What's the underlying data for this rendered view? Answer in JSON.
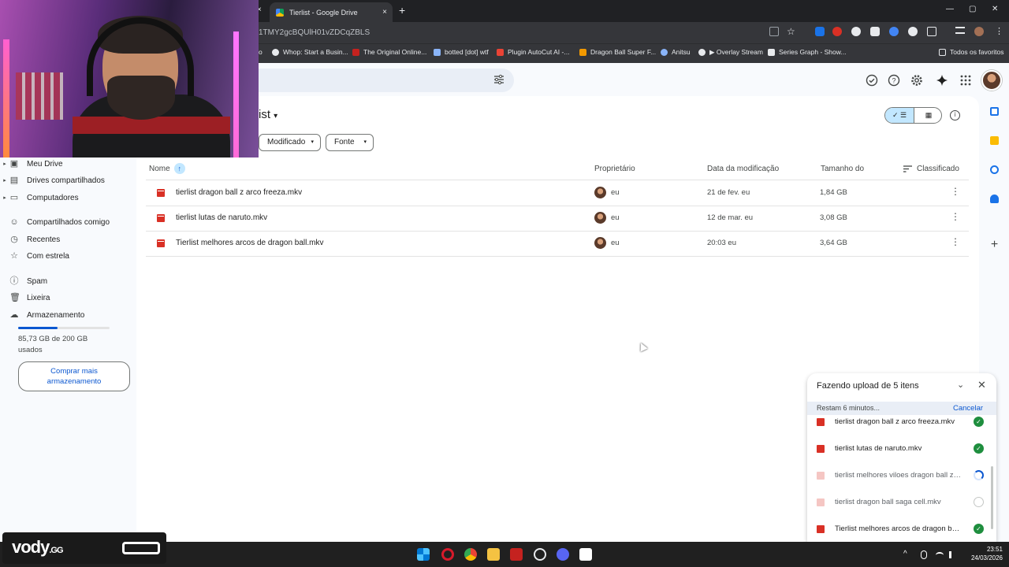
{
  "browser": {
    "tab_title": "Tierlist - Google Drive",
    "tab_close": "×",
    "prev_tab_close": "×",
    "new_tab": "+",
    "url": "1TMY2gcBQUlH01vZDCqZBLS",
    "window_controls": [
      "—",
      "▢",
      "✕"
    ],
    "bookmarks": [
      {
        "label": "o",
        "color": "#9aa0a6"
      },
      {
        "label": "Whop: Start a Busin...",
        "color": "#e8eaed"
      },
      {
        "label": "The Original Online...",
        "color": "#c5221f"
      },
      {
        "label": "botted [dot] wtf",
        "color": "#8ab4f8"
      },
      {
        "label": "Plugin AutoCut AI -...",
        "color": "#ea4335"
      },
      {
        "label": "Dragon Ball Super F...",
        "color": "#f29900"
      },
      {
        "label": "Anitsu",
        "color": "#8ab4f8"
      },
      {
        "label": "▶ Overlay Stream",
        "color": "#e8eaed"
      },
      {
        "label": "Series Graph - Show...",
        "color": "#e8eaed"
      }
    ],
    "all_favorites": "Todos os favoritos"
  },
  "drive": {
    "folder_title": "ist",
    "folder_dropdown": "▾",
    "filters": [
      {
        "label": "Modificado",
        "arrow": "▾"
      },
      {
        "label": "Fonte",
        "arrow": "▾"
      }
    ],
    "view_list_icon": "✓ ☰",
    "view_grid_icon": "▦",
    "info_icon": "i",
    "columns": {
      "name": "Nome",
      "sort_arrow": "↑",
      "owner": "Proprietário",
      "modified": "Data da modificação",
      "size": "Tamanho do",
      "sort_label": "Classificado"
    },
    "files": [
      {
        "name": "tierlist dragon ball z arco freeza.mkv",
        "owner": "eu",
        "modified": "21 de fev. eu",
        "size": "1,84 GB",
        "menu": "⋮"
      },
      {
        "name": "tierlist lutas de naruto.mkv",
        "owner": "eu",
        "modified": "12 de mar. eu",
        "size": "3,08 GB",
        "menu": "⋮"
      },
      {
        "name": "Tierlist melhores arcos de dragon ball.mkv",
        "owner": "eu",
        "modified": "20:03 eu",
        "size": "3,64 GB",
        "menu": "⋮"
      }
    ]
  },
  "sidebar": {
    "items": [
      {
        "label": "Meu Drive",
        "icon": "drive-icon",
        "glyph": "▣",
        "caret": "▸"
      },
      {
        "label": "Drives compartilhados",
        "icon": "shared-drives-icon",
        "glyph": "▤",
        "caret": "▸"
      },
      {
        "label": "Computadores",
        "icon": "computer-icon",
        "glyph": "▭",
        "caret": "▸"
      },
      {
        "label": "Compartilhados comigo",
        "icon": "people-icon",
        "glyph": "☺",
        "caret": ""
      },
      {
        "label": "Recentes",
        "icon": "clock-icon",
        "glyph": "◷",
        "caret": ""
      },
      {
        "label": "Com estrela",
        "icon": "star-icon",
        "glyph": "☆",
        "caret": ""
      },
      {
        "label": "Spam",
        "icon": "spam-icon",
        "glyph": "ⓘ",
        "caret": ""
      },
      {
        "label": "Lixeira",
        "icon": "trash-icon",
        "glyph": "🗑",
        "caret": ""
      },
      {
        "label": "Armazenamento",
        "icon": "cloud-icon",
        "glyph": "☁",
        "caret": ""
      }
    ],
    "storage_used_fraction": 0.43,
    "storage_line1": "85,73 GB de 200 GB",
    "storage_line2": "usados",
    "buy_line1": "Comprar mais",
    "buy_line2": "armazenamento"
  },
  "upload": {
    "title": "Fazendo upload de 5 itens",
    "collapse": "⌄",
    "close": "✕",
    "remaining": "Restam 6 minutos...",
    "cancel": "Cancelar",
    "check": "✓",
    "items": [
      {
        "name": "tierlist dragon ball z arco freeza.mkv",
        "status": "done"
      },
      {
        "name": "tierlist lutas de naruto.mkv",
        "status": "done"
      },
      {
        "name": "tierlist melhores viloes dragon ball z.mkv",
        "status": "uploading"
      },
      {
        "name": "tierlist dragon ball saga cell.mkv",
        "status": "pending"
      },
      {
        "name": "Tierlist melhores arcos de dragon ball.mkv",
        "status": "done"
      }
    ]
  },
  "right_rail": {
    "add": "+"
  },
  "taskbar": {
    "time": "23:51",
    "date": "24/03/2026",
    "tray_caret": "^"
  },
  "overlay": {
    "brand": "vody",
    "brand_suffix": ".GG"
  }
}
